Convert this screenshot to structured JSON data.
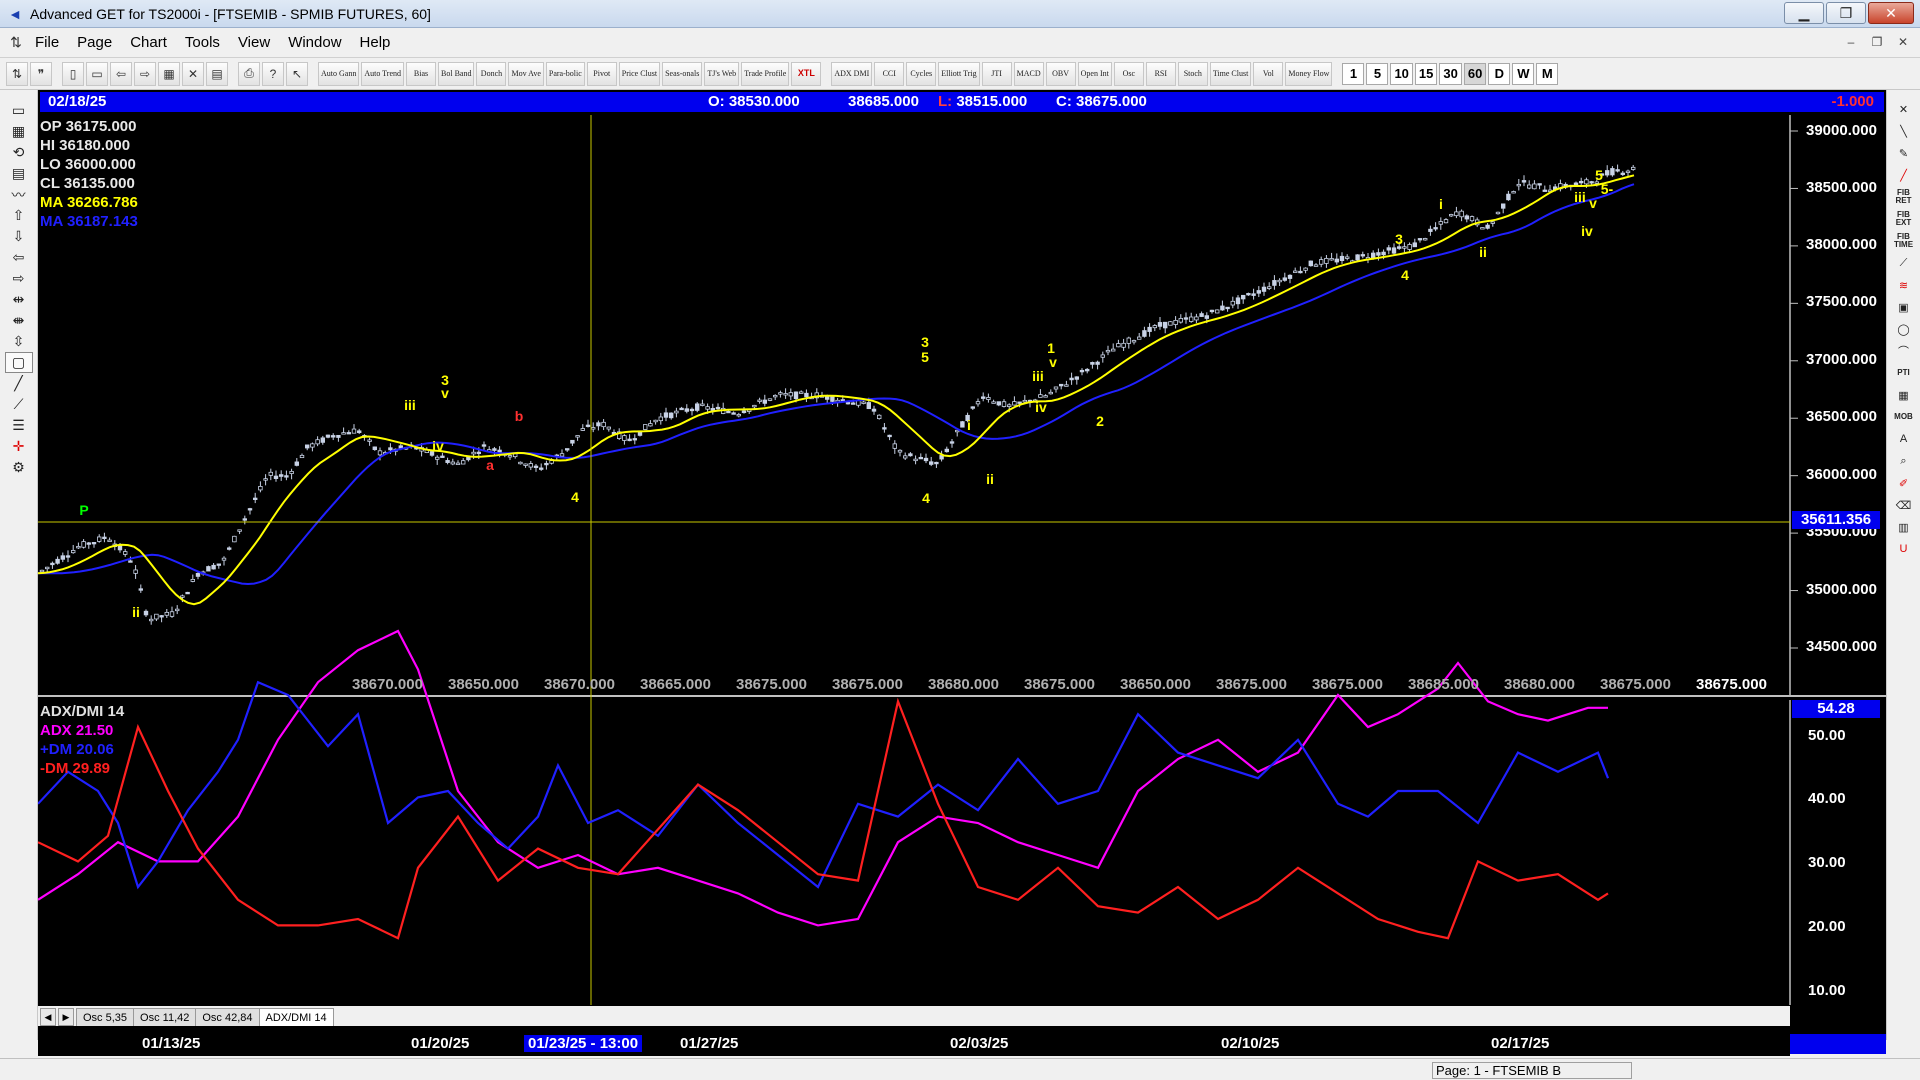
{
  "window": {
    "title": "Advanced GET for TS2000i - [FTSEMIB - SPMIB FUTURES, 60]",
    "app_icon": "get-logo-icon",
    "minimize_icon": "minimize-icon",
    "maximize_icon": "maximize-icon",
    "close_icon": "close-icon"
  },
  "menu": {
    "items": [
      "File",
      "Page",
      "Chart",
      "Tools",
      "View",
      "Window",
      "Help"
    ]
  },
  "toolbar": {
    "indicator_buttons": [
      "Auto Gann",
      "Auto Trend",
      "Bias",
      "Bol Band",
      "Donch",
      "Mov Ave",
      "Para-bolic",
      "Pivot",
      "Price Clust",
      "Seas-onals",
      "TJ's Web",
      "Trade Profile",
      "XTL",
      "ADX DMI",
      "CCI",
      "Cycles",
      "Elliott Trig",
      "JTI",
      "MACD",
      "OBV",
      "Open Int",
      "Osc",
      "RSI",
      "Stoch",
      "Time Clust",
      "Vol",
      "Money Flow"
    ],
    "timeframes": [
      "1",
      "5",
      "10",
      "15",
      "30",
      "60",
      "D",
      "W",
      "M"
    ],
    "active_timeframe": "60"
  },
  "info_bar": {
    "date": "02/18/25",
    "open": "O: 38530.000",
    "high": "38685.000",
    "low_label": "L:",
    "low": "38515.000",
    "close": "C: 38675.000",
    "change": "-1.000"
  },
  "ohlc_cursor": {
    "op": "OP  36175.000",
    "hi": "HI   36180.000",
    "lo": "LO   36000.000",
    "cl": "CL   36135.000",
    "ma1": "MA  36266.786",
    "ma2": "MA  36187.143"
  },
  "price_axis": [
    "39000.000",
    "38500.000",
    "38000.000",
    "37500.000",
    "37000.000",
    "36500.000",
    "36000.000",
    "35500.000",
    "35000.000",
    "34500.000"
  ],
  "cursor_price": "35611.356",
  "bottom_prices": [
    "38670.000",
    "38650.000",
    "38670.000",
    "38665.000",
    "38675.000",
    "38675.000",
    "38680.000",
    "38675.000",
    "38650.000",
    "38675.000",
    "38675.000",
    "38685.000",
    "38680.000",
    "38675.000"
  ],
  "bottom_last_price": "38675.000",
  "waves": {
    "labels": [
      "ii",
      "iii",
      "3",
      "v",
      "iv",
      "a",
      "b",
      "4",
      "3",
      "5",
      "4",
      "i",
      "ii",
      "iii",
      "1",
      "v",
      "iv",
      "2",
      "3",
      "4",
      "i",
      "ii",
      "iii",
      "v",
      "iv",
      "5",
      "5-",
      "P"
    ]
  },
  "indicator": {
    "title": "ADX/DMI 14",
    "adx": "ADX 21.50",
    "plus_dm": "+DM 20.06",
    "minus_dm": "-DM  29.89",
    "tag": "54.28",
    "axis": [
      "50.00",
      "40.00",
      "30.00",
      "20.00",
      "10.00"
    ]
  },
  "tabs": [
    "Osc 5,35",
    "Osc 11,42",
    "Osc 42,84",
    "ADX/DMI 14"
  ],
  "active_tab": "ADX/DMI 14",
  "date_axis": {
    "labels": [
      "01/13/25",
      "01/20/25",
      "01/27/25",
      "02/03/25",
      "02/10/25",
      "02/17/25"
    ],
    "cursor": "01/23/25 - 13:00"
  },
  "status": {
    "page": "Page: 1 - FTSEMIB B"
  },
  "colors": {
    "chart_bg": "#000000",
    "info_bar": "#0000ee",
    "ma_fast": "#ffff00",
    "ma_slow": "#2020ff",
    "adx": "#ff00ff",
    "plus_dm": "#2020ff",
    "minus_dm": "#ff2020",
    "wave_labels": "#ffff00"
  }
}
